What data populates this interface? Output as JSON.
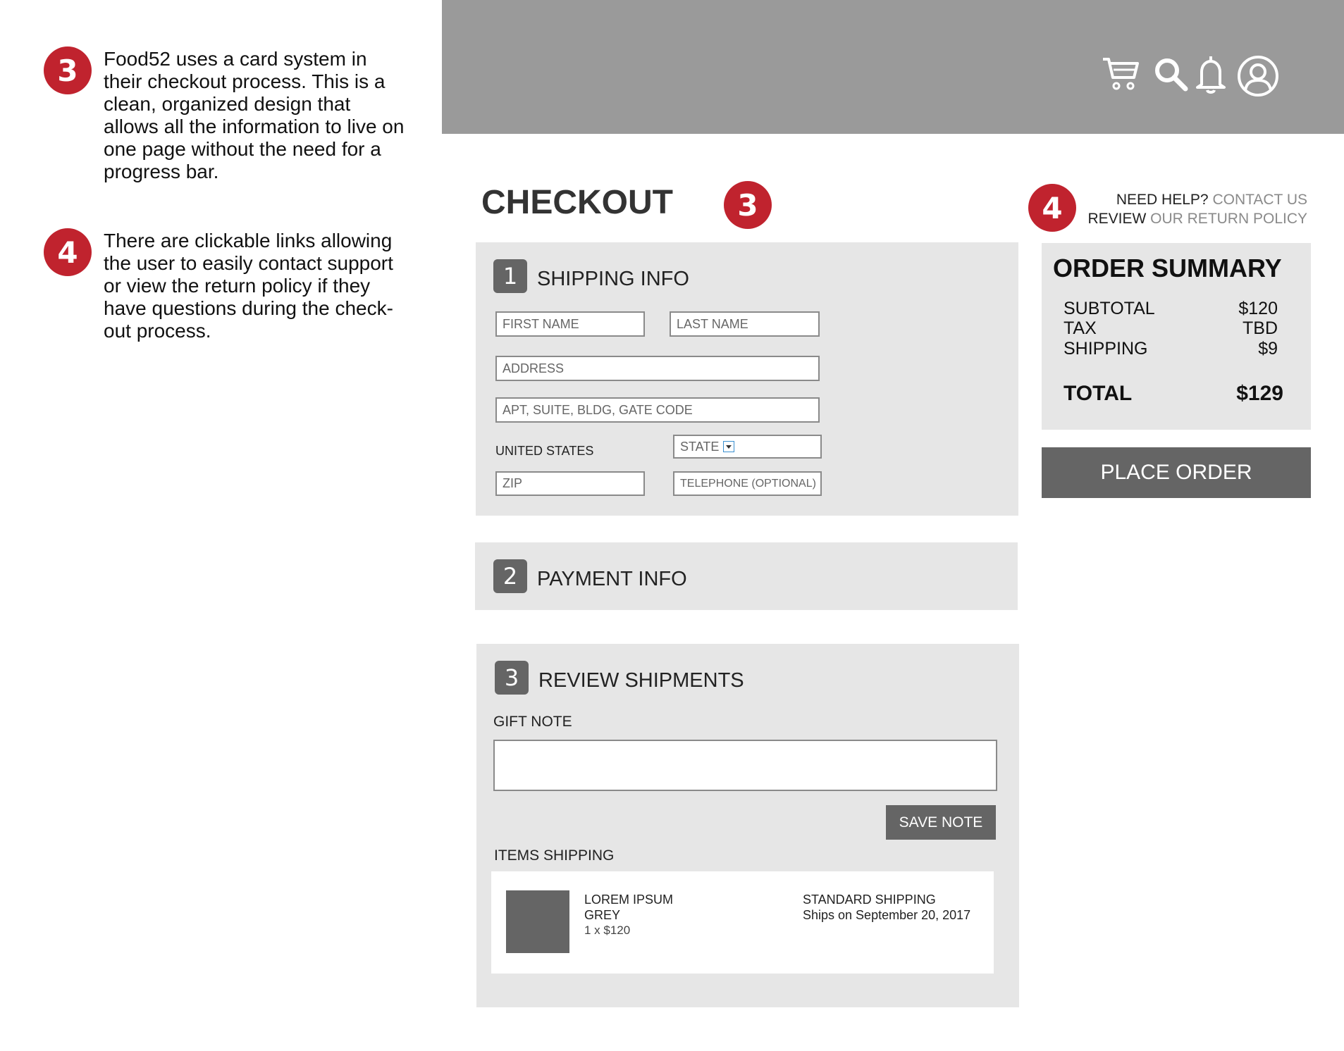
{
  "annotations": [
    {
      "number": "3",
      "text": "Food52 uses a card system in their checkout process. This is a clean, organized design that allows all the information to live on one page without the need for a progress bar."
    },
    {
      "number": "4",
      "text": "There are clickable links allowing the user to easily contact support or view the return policy if they have questions during the check-out process."
    }
  ],
  "header": {
    "icons": [
      "cart-icon",
      "search-icon",
      "bell-icon",
      "user-icon"
    ]
  },
  "checkout": {
    "title": "CHECKOUT",
    "badge": "3"
  },
  "help": {
    "badge": "4",
    "need_help": "NEED HELP?",
    "contact_us": "CONTACT US",
    "review": "REVIEW",
    "return_policy": "OUR RETURN POLICY"
  },
  "shipping": {
    "number": "1",
    "title": "SHIPPING INFO",
    "first_name": "FIRST NAME",
    "last_name": "LAST NAME",
    "address": "ADDRESS",
    "apt": "APT, SUITE, BLDG, GATE CODE",
    "country": "UNITED STATES",
    "state": "STATE",
    "zip": "ZIP",
    "telephone": "TELEPHONE (OPTIONAL)"
  },
  "payment": {
    "number": "2",
    "title": "PAYMENT INFO"
  },
  "review_shipments": {
    "number": "3",
    "title": "REVIEW SHIPMENTS",
    "gift_note_label": "GIFT NOTE",
    "save_note": "SAVE NOTE",
    "items_label": "ITEMS SHIPPING",
    "item": {
      "name": "LOREM IPSUM",
      "color": "GREY",
      "qty_price": "1 x $120",
      "shipping_method": "STANDARD SHIPPING",
      "ship_date": "Ships on September 20, 2017"
    }
  },
  "order_summary": {
    "title": "ORDER SUMMARY",
    "subtotal_label": "SUBTOTAL",
    "subtotal": "$120",
    "tax_label": "TAX",
    "tax": "TBD",
    "shipping_label": "SHIPPING",
    "shipping": "$9",
    "total_label": "TOTAL",
    "total": "$129",
    "place_order": "PLACE ORDER"
  },
  "colors": {
    "accent_red": "#c0232e",
    "header_gray": "#9a9a9a",
    "card_gray": "#e6e6e6",
    "button_gray": "#656565"
  }
}
